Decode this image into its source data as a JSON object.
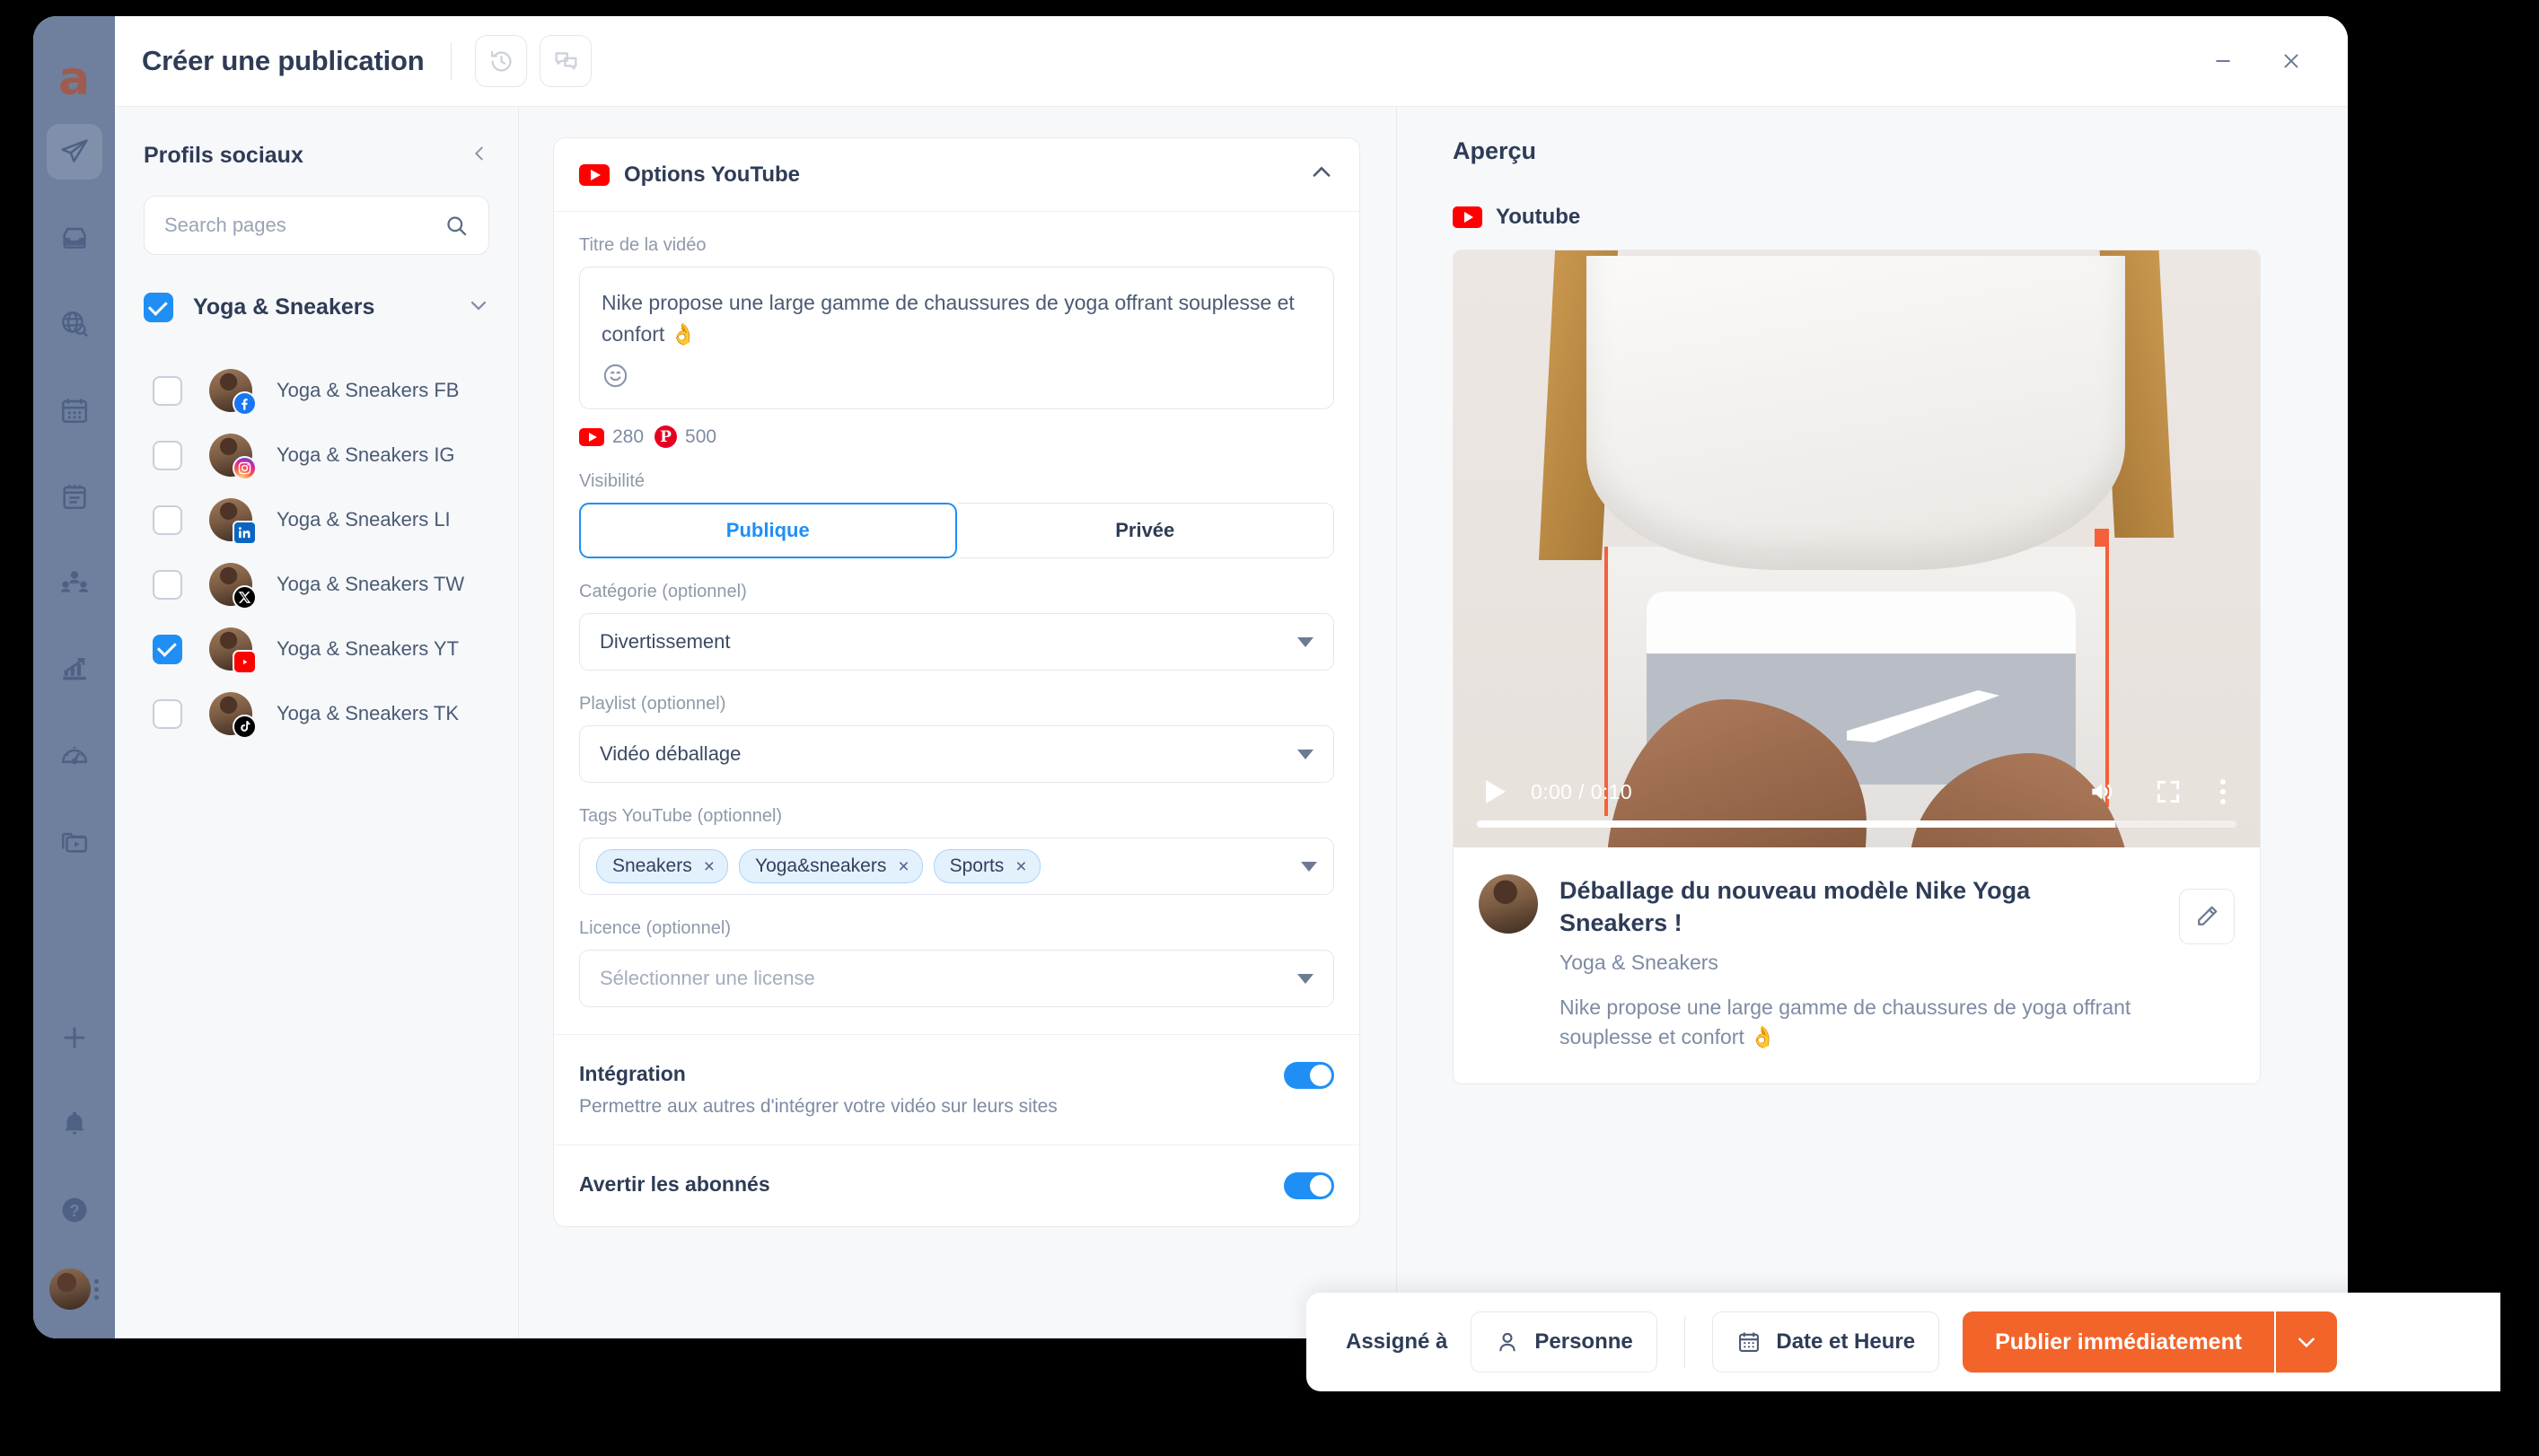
{
  "window": {
    "title": "Créer une publication",
    "minimize_label": "minimize",
    "close_label": "close"
  },
  "header": {
    "history_icon": "history-icon",
    "comments_icon": "comments-icon"
  },
  "rail": {
    "logo": "a",
    "items": [
      {
        "name": "publish",
        "icon": "paper-plane-icon",
        "active": true
      },
      {
        "name": "inbox",
        "icon": "inbox-icon",
        "active": false
      },
      {
        "name": "listening",
        "icon": "globe-search-icon",
        "active": false
      },
      {
        "name": "calendar",
        "icon": "calendar-icon",
        "active": false
      },
      {
        "name": "notes",
        "icon": "notes-icon",
        "active": false
      },
      {
        "name": "audience",
        "icon": "users-icon",
        "active": false
      },
      {
        "name": "analytics",
        "icon": "chart-arrow-icon",
        "active": false
      },
      {
        "name": "dashboard",
        "icon": "speedometer-icon",
        "active": false
      },
      {
        "name": "media",
        "icon": "media-folder-icon",
        "active": false
      },
      {
        "name": "add",
        "icon": "plus-icon",
        "active": false
      },
      {
        "name": "notifications",
        "icon": "bell-icon",
        "active": false
      },
      {
        "name": "help",
        "icon": "question-circle-icon",
        "active": false
      }
    ]
  },
  "profiles": {
    "title": "Profils sociaux",
    "collapse_icon": "chevron-left-icon",
    "search_placeholder": "Search pages",
    "search_value": "",
    "search_icon": "search-icon",
    "group": {
      "label": "Yoga & Sneakers",
      "checked": true,
      "chevron": "chevron-down-icon"
    },
    "items": [
      {
        "label": "Yoga & Sneakers FB",
        "network": "facebook",
        "checked": false
      },
      {
        "label": "Yoga & Sneakers IG",
        "network": "instagram",
        "checked": false
      },
      {
        "label": "Yoga & Sneakers LI",
        "network": "linkedin",
        "checked": false
      },
      {
        "label": "Yoga & Sneakers TW",
        "network": "x",
        "checked": false
      },
      {
        "label": "Yoga & Sneakers YT",
        "network": "youtube",
        "checked": true
      },
      {
        "label": "Yoga & Sneakers TK",
        "network": "tiktok",
        "checked": false
      }
    ]
  },
  "youtube_options": {
    "card_title": "Options YouTube",
    "collapse_icon": "chevron-up-icon",
    "title_field": {
      "label": "Titre de la vidéo",
      "value": "Nike propose une large gamme de chaussures de yoga offrant souplesse et confort 👌",
      "emoji_icon": "emoji-smile-icon"
    },
    "counters": [
      {
        "network": "youtube",
        "value": "280"
      },
      {
        "network": "pinterest",
        "value": "500"
      }
    ],
    "visibility": {
      "label": "Visibilité",
      "options": [
        "Publique",
        "Privée"
      ],
      "selected": "Publique"
    },
    "category": {
      "label": "Catégorie (optionnel)",
      "value": "Divertissement"
    },
    "playlist": {
      "label": "Playlist (optionnel)",
      "value": "Vidéo déballage"
    },
    "tags": {
      "label": "Tags YouTube (optionnel)",
      "values": [
        "Sneakers",
        "Yoga&sneakers",
        "Sports"
      ],
      "remove_label": "×"
    },
    "license": {
      "label": "Licence (optionnel)",
      "placeholder": "Sélectionner une license",
      "value": ""
    },
    "embed": {
      "title": "Intégration",
      "subtitle": "Permettre aux autres d'intégrer votre vidéo sur leurs sites",
      "enabled": true
    },
    "notify": {
      "title": "Avertir les abonnés",
      "enabled": true
    }
  },
  "preview": {
    "title": "Aperçu",
    "network_label": "Youtube",
    "video": {
      "current_time": "0:00",
      "duration": "0:10",
      "time_display": "0:00 / 0:10",
      "play_icon": "play-icon",
      "volume_icon": "volume-icon",
      "fullscreen_icon": "fullscreen-icon",
      "more_icon": "kebab-menu-icon",
      "progress_percent": 84
    },
    "post_title": "Déballage du nouveau modèle Nike Yoga Sneakers !",
    "channel": "Yoga & Sneakers",
    "description": "Nike propose une large gamme de chaussures de yoga offrant souplesse et confort 👌",
    "edit_icon": "pencil-icon"
  },
  "action_bar": {
    "assign_label": "Assigné à",
    "person_button": "Personne",
    "person_icon": "user-icon",
    "date_button": "Date et Heure",
    "date_icon": "calendar-icon",
    "publish_button": "Publier immédiatement",
    "publish_caret_icon": "chevron-down-icon"
  },
  "colors": {
    "accent_blue": "#1f8ff5",
    "publish_orange": "#f2642a",
    "youtube_red": "#ff0000",
    "pinterest_red": "#e60023",
    "text_dark": "#2e3c56"
  }
}
